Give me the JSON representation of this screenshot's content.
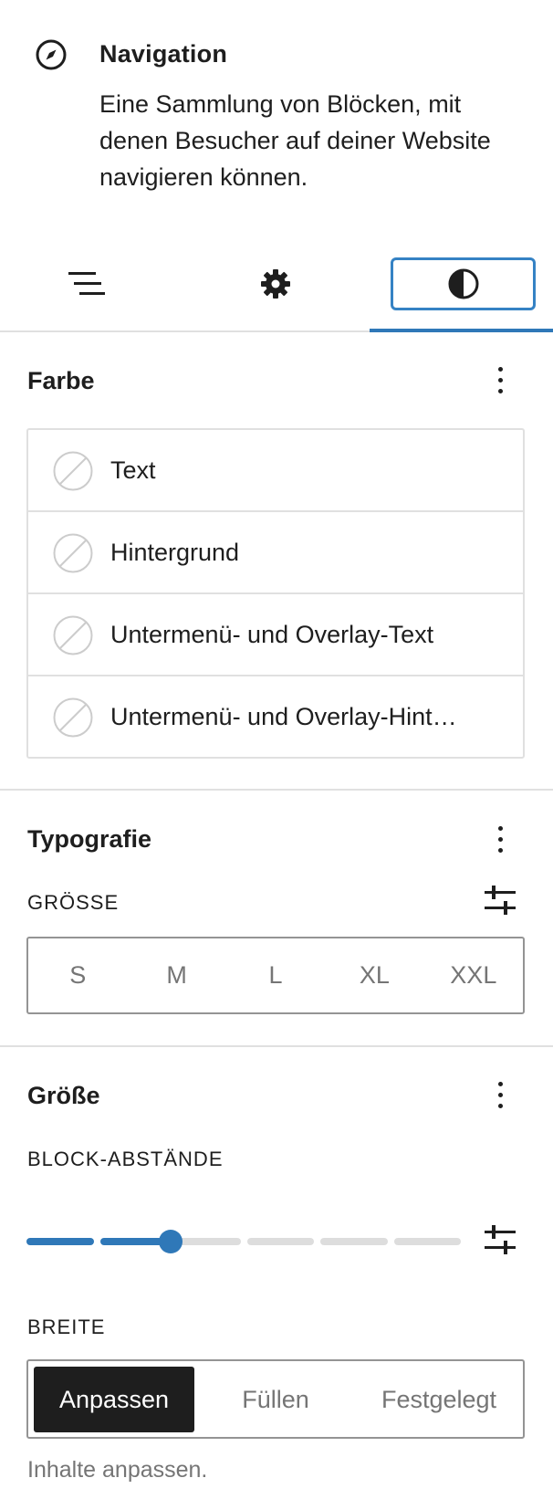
{
  "block": {
    "title": "Navigation",
    "description": "Eine Sammlung von Blöcken, mit denen Besucher auf deiner Website navigieren können.",
    "icon": "compass-icon"
  },
  "tabs": [
    {
      "name": "list-view",
      "icon": "list-view-icon"
    },
    {
      "name": "settings",
      "icon": "gear-icon"
    },
    {
      "name": "styles",
      "icon": "half-circle-contrast-icon",
      "active": true
    }
  ],
  "color": {
    "title": "Farbe",
    "items": [
      {
        "label": "Text"
      },
      {
        "label": "Hintergrund"
      },
      {
        "label": "Untermenü- und Overlay-Text"
      },
      {
        "label": "Untermenü- und Overlay-Hint…"
      }
    ]
  },
  "typography": {
    "title": "Typografie",
    "size_label": "GRÖSSE",
    "sizes": [
      "S",
      "M",
      "L",
      "XL",
      "XXL"
    ]
  },
  "dimensions": {
    "title": "Größe",
    "spacing_label": "BLOCK-ABSTÄNDE",
    "spacing_steps": 6,
    "spacing_value_step": 2,
    "width_label": "BREITE",
    "width_options": [
      "Anpassen",
      "Füllen",
      "Festgelegt"
    ],
    "width_selected": "Anpassen",
    "width_help": "Inhalte anpassen."
  },
  "colors": {
    "accent": "#2f78b8",
    "focus": "#3582c4",
    "border": "#e0e0e0",
    "muted": "#757575"
  }
}
